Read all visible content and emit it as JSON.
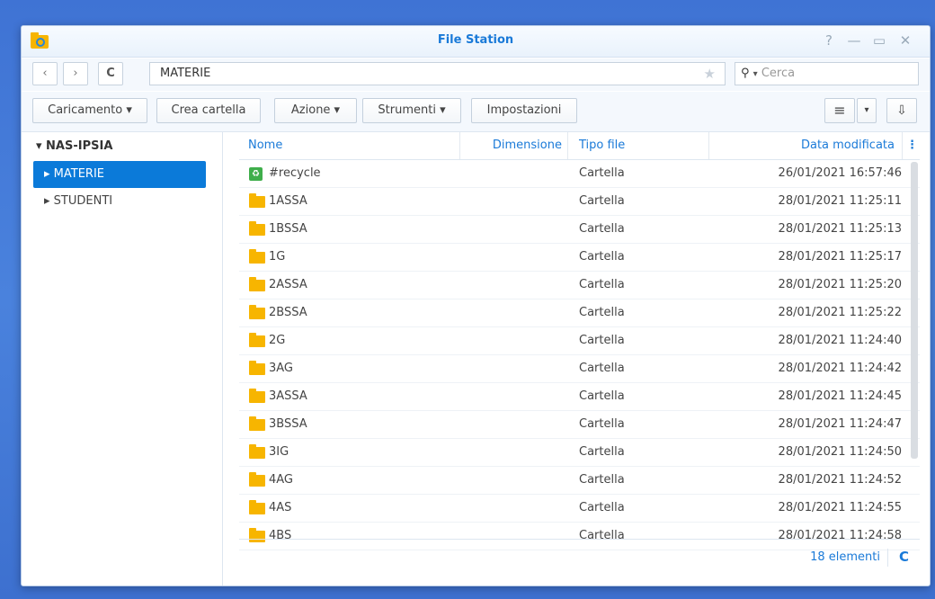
{
  "window": {
    "title": "File Station"
  },
  "nav": {
    "back_icon": "‹",
    "forward_icon": "›",
    "refresh_icon": "C",
    "path": "MATERIE",
    "star_icon": "★",
    "search_placeholder": "Cerca",
    "search_icon": "⚲"
  },
  "toolbar": {
    "upload": "Caricamento ▾",
    "new_folder": "Crea cartella",
    "action": "Azione ▾",
    "tools": "Strumenti ▾",
    "settings": "Impostazioni",
    "view_list_icon": "≡",
    "view_dropdown_icon": "▾",
    "sort_icon": "⇩"
  },
  "sidebar": {
    "root": "▾ NAS-IPSIA",
    "items": [
      {
        "label": "▸ MATERIE",
        "selected": true
      },
      {
        "label": "▸ STUDENTI",
        "selected": false
      }
    ]
  },
  "table": {
    "headers": {
      "name": "Nome",
      "size": "Dimensione",
      "type": "Tipo file",
      "modified": "Data modificata",
      "more_icon": "⋮"
    },
    "rows": [
      {
        "name": "#recycle",
        "type": "Cartella",
        "modified": "26/01/2021 16:57:46",
        "icon": "recycle-icon"
      },
      {
        "name": "1ASSA",
        "type": "Cartella",
        "modified": "28/01/2021 11:25:11",
        "icon": "folder-icon"
      },
      {
        "name": "1BSSA",
        "type": "Cartella",
        "modified": "28/01/2021 11:25:13",
        "icon": "folder-icon"
      },
      {
        "name": "1G",
        "type": "Cartella",
        "modified": "28/01/2021 11:25:17",
        "icon": "folder-icon"
      },
      {
        "name": "2ASSA",
        "type": "Cartella",
        "modified": "28/01/2021 11:25:20",
        "icon": "folder-icon"
      },
      {
        "name": "2BSSA",
        "type": "Cartella",
        "modified": "28/01/2021 11:25:22",
        "icon": "folder-icon"
      },
      {
        "name": "2G",
        "type": "Cartella",
        "modified": "28/01/2021 11:24:40",
        "icon": "folder-icon"
      },
      {
        "name": "3AG",
        "type": "Cartella",
        "modified": "28/01/2021 11:24:42",
        "icon": "folder-icon"
      },
      {
        "name": "3ASSA",
        "type": "Cartella",
        "modified": "28/01/2021 11:24:45",
        "icon": "folder-icon"
      },
      {
        "name": "3BSSA",
        "type": "Cartella",
        "modified": "28/01/2021 11:24:47",
        "icon": "folder-icon"
      },
      {
        "name": "3IG",
        "type": "Cartella",
        "modified": "28/01/2021 11:24:50",
        "icon": "folder-icon"
      },
      {
        "name": "4AG",
        "type": "Cartella",
        "modified": "28/01/2021 11:24:52",
        "icon": "folder-icon"
      },
      {
        "name": "4AS",
        "type": "Cartella",
        "modified": "28/01/2021 11:24:55",
        "icon": "folder-icon"
      },
      {
        "name": "4BS",
        "type": "Cartella",
        "modified": "28/01/2021 11:24:58",
        "icon": "folder-icon"
      }
    ]
  },
  "footer": {
    "count": "18 elementi",
    "refresh_icon": "C"
  },
  "colors": {
    "accent": "#1a7ad8",
    "selection": "#0b7ad9",
    "folder": "#f7b500",
    "desktop": "#3f73d4"
  }
}
